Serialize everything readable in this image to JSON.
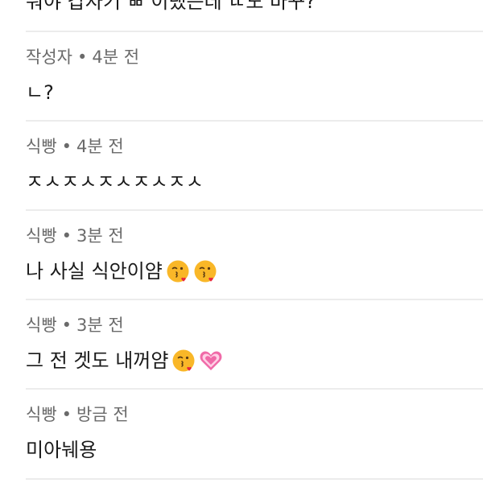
{
  "top_partial_text": "뭐야 갑자기 ㅃ 이랬는데 ㄸ도 바꾸?",
  "comments": [
    {
      "author": "작성자",
      "separator": "•",
      "time": "4분 전",
      "text": "ㄴ?",
      "emojis": []
    },
    {
      "author": "식빵",
      "separator": "•",
      "time": "4분 전",
      "text": "ㅈㅅㅈㅅㅈㅅㅈㅅㅈㅅ",
      "emojis": []
    },
    {
      "author": "식빵",
      "separator": "•",
      "time": "3분 전",
      "text": "나 사실 식안이얌",
      "emojis": [
        "kissing-face-icon",
        "kissing-face-icon"
      ]
    },
    {
      "author": "식빵",
      "separator": "•",
      "time": "3분 전",
      "text": "그 전 겟도 내꺼얌",
      "emojis": [
        "kissing-face-icon",
        "growing-heart-icon"
      ]
    },
    {
      "author": "식빵",
      "separator": "•",
      "time": "방금 전",
      "text": "미아눼용",
      "emojis": []
    }
  ],
  "colors": {
    "text_primary": "#1a1a1a",
    "text_meta": "#6a6a6a",
    "divider": "#ececec",
    "emoji_face": "#f9b728",
    "emoji_heart_red": "#e8263d",
    "heart_pink": "#f06aa8"
  }
}
